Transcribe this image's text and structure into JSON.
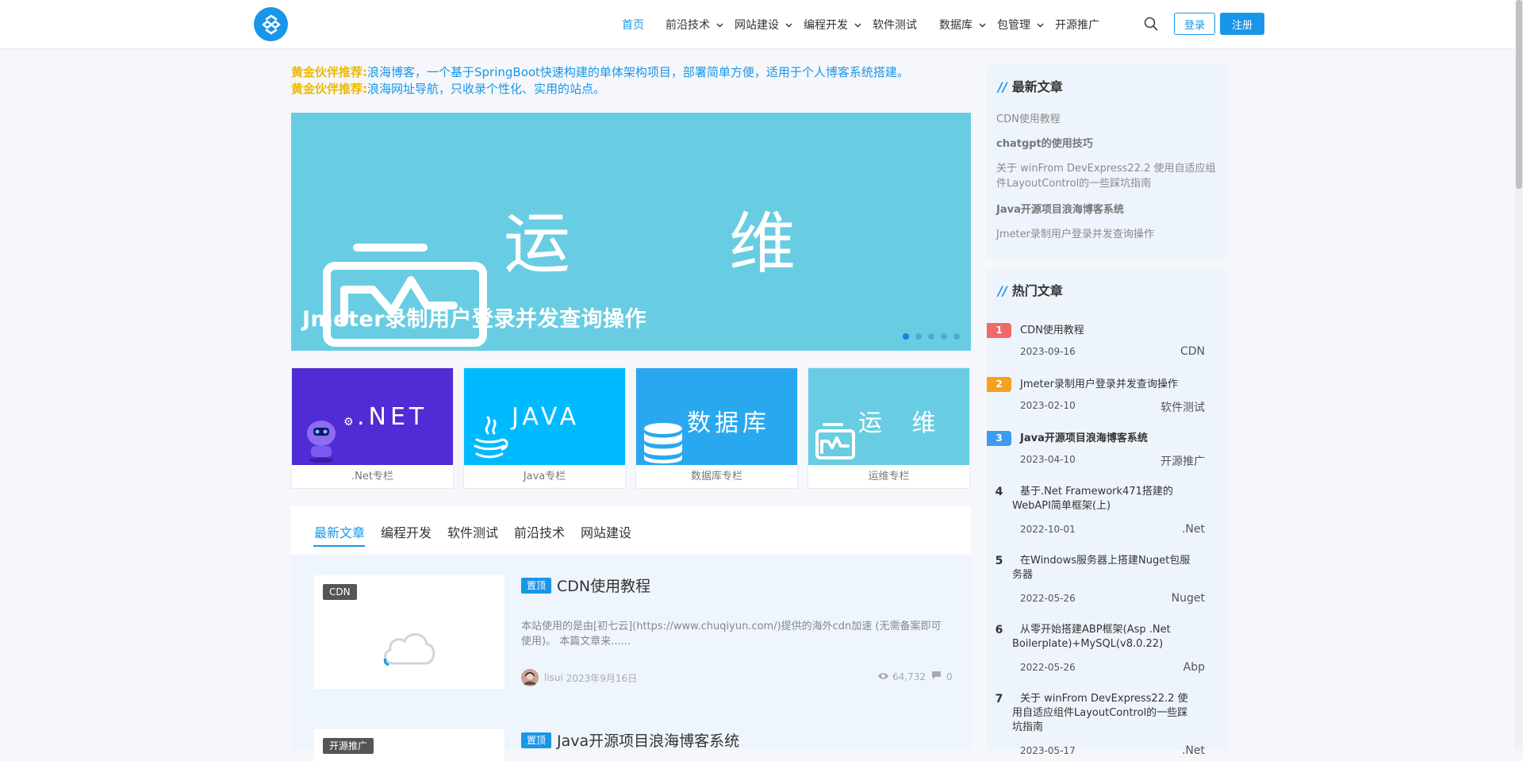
{
  "nav": {
    "items": [
      {
        "label": "首页"
      },
      {
        "label": "前沿技术"
      },
      {
        "label": "网站建设"
      },
      {
        "label": "编程开发"
      },
      {
        "label": "软件测试"
      },
      {
        "label": "数据库"
      },
      {
        "label": "包管理"
      },
      {
        "label": "开源推广"
      }
    ],
    "login": "登录",
    "register": "注册"
  },
  "promos": [
    {
      "label": "黄金伙伴推荐:",
      "text": "浪海博客，一个基于SpringBoot快速构建的单体架构项目，部署简单方便，适用于个人博客系统搭建。"
    },
    {
      "label": "黄金伙伴推荐:",
      "text": "浪海网址导航，只收录个性化、实用的站点。"
    }
  ],
  "banner": {
    "big_left": "运",
    "big_right": "维",
    "title": "Jmeter录制用户登录并发查询操作",
    "active_slide": 1,
    "slide_count": 5
  },
  "categories": [
    {
      "word": ".NET",
      "caption": ".Net专栏",
      "color": "#512bd4"
    },
    {
      "word": "JAVA",
      "caption": "Java专栏",
      "color": "#00baff"
    },
    {
      "word": "数据库",
      "caption": "数据库专栏",
      "color": "#29a8f0"
    },
    {
      "word": "运 维",
      "caption": "运维专栏",
      "color": "#68cde2"
    }
  ],
  "tabs": [
    "最新文章",
    "编程开发",
    "软件测试",
    "前沿技术",
    "网站建设"
  ],
  "articles": [
    {
      "category": "CDN",
      "pin": "置顶",
      "title": "CDN使用教程",
      "excerpt": "本站使用的是由[初七云](https://www.chuqiyun.com/)提供的海外cdn加速 (无需备案即可使用)。 本篇文章来......",
      "author": "lisui",
      "date": "2023年9月16日",
      "views": "64,732",
      "comments": "0"
    },
    {
      "category": "开源推广",
      "pin": "置顶",
      "title": "Java开源项目浪海博客系统"
    }
  ],
  "sidebar": {
    "latest_title": "最新文章",
    "latest": [
      "CDN使用教程",
      "chatgpt的使用技巧",
      "关于 winFrom DevExpress22.2 使用自适应组件LayoutControl的一些踩坑指南",
      "Java开源项目浪海博客系统",
      "Jmeter录制用户登录并发查询操作"
    ],
    "hot_title": "热门文章",
    "hot": [
      {
        "rank": "1",
        "title": "CDN使用教程",
        "date": "2023-09-16",
        "cat": "CDN",
        "color": "#f06a6a"
      },
      {
        "rank": "2",
        "title": "Jmeter录制用户登录并发查询操作",
        "date": "2023-02-10",
        "cat": "软件测试",
        "color": "#f5a21d"
      },
      {
        "rank": "3",
        "title": "Java开源项目浪海博客系统",
        "date": "2023-04-10",
        "cat": "开源推广",
        "color": "#3d9cf0"
      },
      {
        "rank": "4",
        "title": "基于.Net Framework471搭建的WebAPI简单框架(上)",
        "date": "2022-10-01",
        "cat": ".Net"
      },
      {
        "rank": "5",
        "title": "在Windows服务器上搭建Nuget包服务器",
        "date": "2022-05-26",
        "cat": "Nuget"
      },
      {
        "rank": "6",
        "title": "从零开始搭建ABP框架(Asp .Net Boilerplate)+MySQL(v8.0.22)",
        "date": "2022-05-26",
        "cat": "Abp"
      },
      {
        "rank": "7",
        "title": "关于 winFrom DevExpress22.2 使用自适应组件LayoutControl的一些踩坑指南",
        "date": "2023-05-17",
        "cat": ".Net"
      }
    ]
  }
}
